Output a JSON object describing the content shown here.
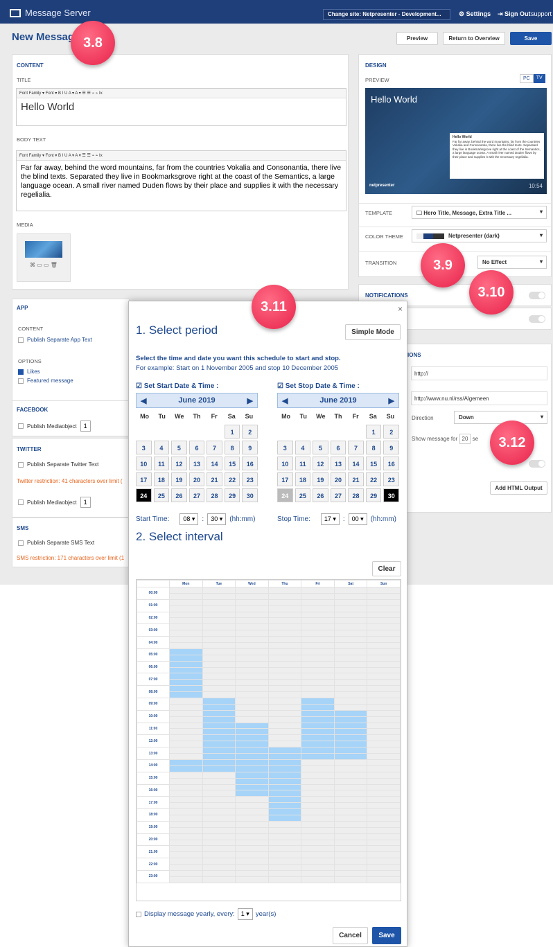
{
  "app": {
    "title": "Message Server",
    "site": "Change site: Netpresenter - Development...",
    "settings": "Settings",
    "signout": "Sign Out",
    "support": "support"
  },
  "page": {
    "title": "New Message",
    "preview_btn": "Preview",
    "return_btn": "Return to Overview",
    "save_btn": "Save"
  },
  "content": {
    "header": "CONTENT",
    "title_label": "TITLE",
    "title_value": "Hello World",
    "body_label": "BODY TEXT",
    "body_value": "Far far away, behind the word mountains, far from the countries Vokalia and Consonantia, there live the blind texts. Separated they live in Bookmarksgrove right at the coast of the Semantics, a large language ocean. A small river named Duden flows by their place and supplies it with the necessary regelialia.",
    "media_label": "MEDIA",
    "toolbar_text": "Font Family ▾ Font ▾  B I U  A ▾ A ▾  ☰ ☰  ⌁ ⌁ Ix"
  },
  "app_section": {
    "header": "APP",
    "content_label": "CONTENT",
    "publish_app": "Publish Separate App Text",
    "options_label": "OPTIONS",
    "likes": "Likes",
    "featured": "Featured message"
  },
  "facebook": {
    "header": "FACEBOOK",
    "publish": "Publish Mediaobject",
    "count": "1"
  },
  "twitter": {
    "header": "TWITTER",
    "publish": "Publish Separate Twitter Text",
    "restriction": "Twitter restriction: 41 characters over limit (",
    "media": "Publish Mediaobject",
    "count": "1"
  },
  "sms": {
    "header": "SMS",
    "publish": "Publish Separate SMS Text",
    "restriction": "SMS restriction: 171 characters over limit (1"
  },
  "design": {
    "header": "DESIGN",
    "preview_label": "PREVIEW",
    "pc": "PC",
    "tv": "TV",
    "preview_title": "Hello World",
    "preview_small_title": "Hello World",
    "preview_small_body": "Far far away, behind the word mountains, far from the countries Vokalia and Consonantia, there live the blind texts. Separated they live in Bookmarksgrove right at the coast of the Semantics, a large language ocean. A small river named Duden flows by their place and supplies it with the necessary regelialia.",
    "preview_brand": "netpresenter",
    "preview_time": "10:54",
    "template_label": "TEMPLATE",
    "template_value": "Hero Title, Message, Extra Title ...",
    "theme_label": "COLOR THEME",
    "theme_value": "Netpresenter (dark)",
    "transition_label": "TRANSITION",
    "transition_value": "No Effect"
  },
  "notifications": {
    "header": "NOTIFICATIONS"
  },
  "options_right": {
    "header": "IONS",
    "url1": "http://",
    "url2": "http://www.nu.nl/rss/Algemeen",
    "direction_label": "Direction",
    "direction_value": "Down",
    "show_label": "Show message for",
    "show_value": "20",
    "show_unit": "se",
    "html_btn": "Add HTML Output"
  },
  "badges": [
    "3.8",
    "3.9",
    "3.10",
    "3.11",
    "3.12"
  ],
  "modal": {
    "close": "×",
    "step1": "1. Select period",
    "simple_mode": "Simple Mode",
    "instr1": "Select the time and date you want this schedule to start and stop.",
    "instr2": "For example: Start on 1 November 2005 and stop 10 December 2005",
    "start_chk": "Set Start Date & Time :",
    "stop_chk": "Set Stop Date & Time :",
    "month": "June 2019",
    "weekdays": [
      "Mo",
      "Tu",
      "We",
      "Th",
      "Fr",
      "Sa",
      "Su"
    ],
    "start_time_label": "Start Time:",
    "start_h": "08",
    "start_m": "30",
    "stop_time_label": "Stop Time:",
    "stop_h": "17",
    "stop_m": "00",
    "hhmm": "(hh:mm)",
    "step2": "2. Select interval",
    "clear": "Clear",
    "days": [
      "Mon",
      "Tue",
      "Wed",
      "Thu",
      "Fri",
      "Sat",
      "Sun"
    ],
    "hours": [
      "00:00",
      "01:00",
      "02:00",
      "03:00",
      "04:00",
      "05:00",
      "06:00",
      "07:00",
      "08:00",
      "09:00",
      "10:00",
      "11:00",
      "12:00",
      "13:00",
      "14:00",
      "15:00",
      "16:00",
      "17:00",
      "18:00",
      "19:00",
      "20:00",
      "21:00",
      "22:00",
      "23:00"
    ],
    "yearly": "Display message yearly, every:",
    "yearly_n": "1",
    "yearly_unit": "year(s)",
    "cancel": "Cancel",
    "save": "Save"
  }
}
